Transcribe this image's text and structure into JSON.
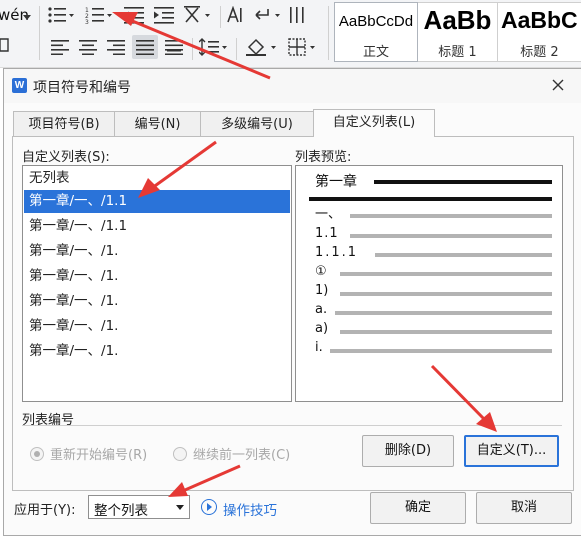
{
  "ribbon": {
    "font_fragment": "wén",
    "styles": [
      {
        "sample": "AaBbCcDd",
        "name": "正文"
      },
      {
        "sample": "AaBb",
        "name": "标题 1"
      },
      {
        "sample": "AaBbC",
        "name": "标题 2"
      }
    ]
  },
  "dialog": {
    "title": "项目符号和编号",
    "tabs": [
      "项目符号(B)",
      "编号(N)",
      "多级编号(U)",
      "自定义列表(L)"
    ],
    "custom_list_label": "自定义列表(S):",
    "custom_list_items": [
      "无列表",
      "第一章/一、/1.1",
      "第一章/一、/1.1",
      "第一章/一、/1.",
      "第一章/一、/1.",
      "第一章/一、/1.",
      "第一章/一、/1.",
      "第一章/一、/1."
    ],
    "selected_index": 1,
    "preview_label": "列表预览:",
    "preview_levels": [
      "第一章",
      "一、",
      "1.1",
      "1.1.1",
      "①",
      "1)",
      "a.",
      "a)",
      "i."
    ],
    "list_numbering_label": "列表编号",
    "radio_restart": "重新开始编号(R)",
    "radio_continue": "继续前一列表(C)",
    "delete_button": "删除(D)",
    "customize_button": "自定义(T)...",
    "apply_to_label": "应用于(Y):",
    "apply_to_value": "整个列表",
    "tips_link": "操作技巧",
    "ok_button": "确定",
    "cancel_button": "取消"
  },
  "colors": {
    "accent": "#2a73d9",
    "annotation_arrow": "#e53935"
  }
}
